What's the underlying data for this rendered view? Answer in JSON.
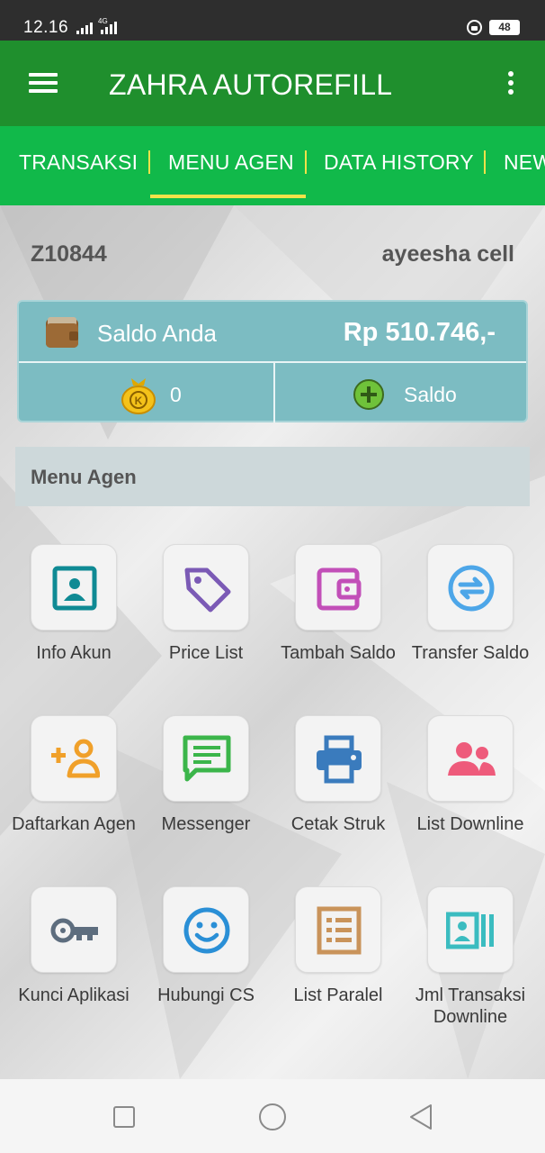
{
  "status_bar": {
    "time": "12.16",
    "network": "4G",
    "battery": "48",
    "icons": [
      "signal-icon",
      "lock-icon",
      "battery-icon"
    ]
  },
  "app_bar": {
    "title": "ZAHRA AUTOREFILL",
    "icons": [
      "hamburger-menu-icon",
      "overflow-menu-icon"
    ]
  },
  "tabs": [
    {
      "label": "TRANSAKSI",
      "active": false
    },
    {
      "label": "MENU AGEN",
      "active": true
    },
    {
      "label": "DATA HISTORY",
      "active": false
    },
    {
      "label": "NEWS",
      "active": false
    }
  ],
  "account": {
    "id": "Z10844",
    "name": "ayeesha cell"
  },
  "balance": {
    "label": "Saldo Anda",
    "value": "Rp 510.746,-",
    "coins": "0",
    "add_label": "Saldo"
  },
  "section": {
    "title": "Menu Agen"
  },
  "menu_items": [
    {
      "label": "Info Akun",
      "icon": "contact-card-icon",
      "color": "#0f8a94"
    },
    {
      "label": "Price List",
      "icon": "price-tag-icon",
      "color": "#7b5ab5"
    },
    {
      "label": "Tambah Saldo",
      "icon": "wallet-icon",
      "color": "#c24fb8"
    },
    {
      "label": "Transfer Saldo",
      "icon": "transfer-icon",
      "color": "#4da6e8"
    },
    {
      "label": "Daftarkan Agen",
      "icon": "add-user-icon",
      "color": "#f0a02a"
    },
    {
      "label": "Messenger",
      "icon": "message-icon",
      "color": "#3bb54a"
    },
    {
      "label": "Cetak Struk",
      "icon": "printer-icon",
      "color": "#3a7bbd"
    },
    {
      "label": "List Downline",
      "icon": "users-icon",
      "color": "#ee5b7b"
    },
    {
      "label": "Kunci Aplikasi",
      "icon": "key-icon",
      "color": "#5d6d7e"
    },
    {
      "label": "Hubungi CS",
      "icon": "smiley-icon",
      "color": "#2a8fd6"
    },
    {
      "label": "List Paralel",
      "icon": "list-icon",
      "color": "#c9935a"
    },
    {
      "label": "Jml Transaksi Downline",
      "icon": "report-icon",
      "color": "#3bbcc0"
    }
  ],
  "colors": {
    "app_bar": "#1f8f2d",
    "tab_bar": "#11b94a",
    "tab_indicator": "#f3e24a",
    "balance_card": "#7cbcc2"
  },
  "nav_bar": {
    "icons": [
      "recent-apps-icon",
      "home-icon",
      "back-icon"
    ]
  }
}
